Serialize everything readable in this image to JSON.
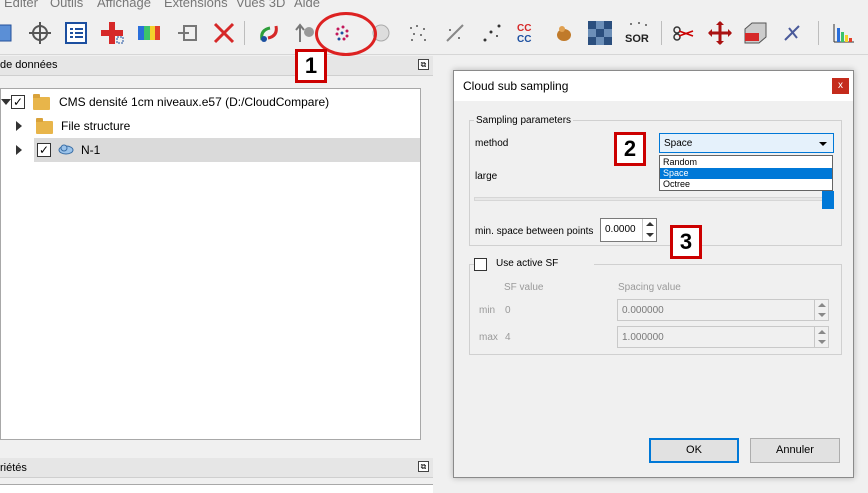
{
  "menu": [
    "Editer",
    "Outils",
    "Affichage",
    "Extensions",
    "Vues 3D",
    "Aide"
  ],
  "toolbar": {
    "icons": [
      "open-icon",
      "point-picking-icon",
      "list-icon",
      "cross-section-icon",
      "color-scale-icon",
      "exit-icon",
      "delete-icon",
      "merge-icon",
      "level-icon",
      "subsample-icon",
      "mesh-icon",
      "noise-icon",
      "sample-icon",
      "crop-icon",
      "ccc-icon",
      "fill-icon",
      "checker-icon",
      "sor-icon",
      "scissors-icon",
      "translate-icon",
      "box-icon",
      "pick-icon",
      "histogram-icon"
    ],
    "ccc_text": "CC\nCC",
    "sor_text": "SOR"
  },
  "db_panel": {
    "title": "de données",
    "items": [
      {
        "label": "CMS densité 1cm niveaux.e57 (D:/CloudCompare)",
        "checked": true
      },
      {
        "label": "File structure"
      },
      {
        "label": "N-1",
        "checked": true
      }
    ]
  },
  "properties_panel": {
    "title": "riétés"
  },
  "dialog": {
    "title": "Cloud sub sampling",
    "close_label": "x",
    "sampling_group": "Sampling parameters",
    "method_label": "method",
    "method_value": "Space",
    "method_options": [
      "Random",
      "Space",
      "Octree"
    ],
    "selected_option": "Space",
    "large_label": "large",
    "min_space_label": "min. space between points",
    "min_space_value": "0.0000",
    "use_active_sf_label": "Use active SF",
    "sf_value_header": "SF value",
    "spacing_value_header": "Spacing value",
    "min_label": "min",
    "min_sf": "0",
    "min_spacing": "0.000000",
    "max_label": "max",
    "max_sf": "4",
    "max_spacing": "1.000000",
    "ok_label": "OK",
    "cancel_label": "Annuler"
  },
  "annotations": [
    "1",
    "2",
    "3"
  ],
  "colors": {
    "accent": "#0078d7",
    "annotation": "#cc0000",
    "close": "#c42b1c"
  }
}
